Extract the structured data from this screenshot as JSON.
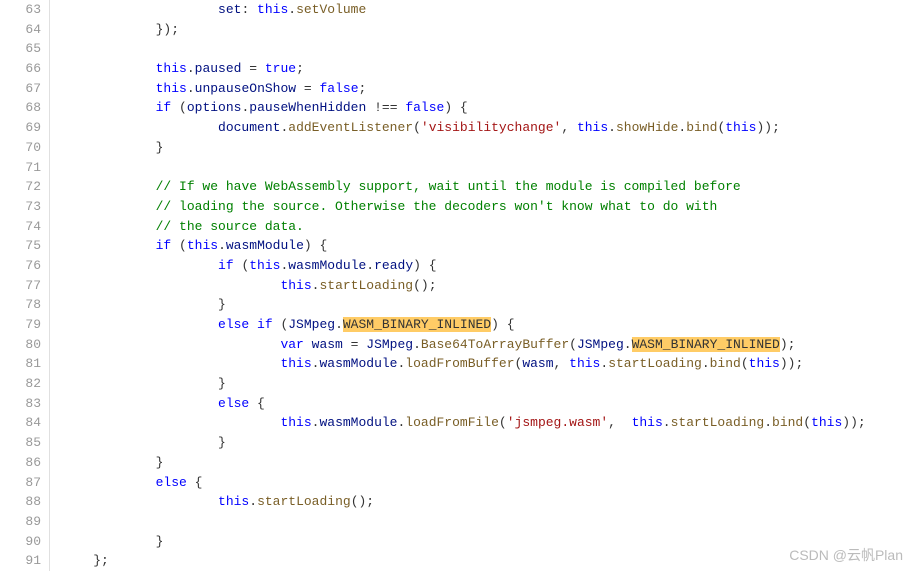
{
  "startLine": 63,
  "watermark": "CSDN @云帆Plan",
  "code": [
    {
      "i": "                    ",
      "t": [
        [
          "id",
          "set"
        ],
        [
          "p",
          ": "
        ],
        [
          "kw",
          "this"
        ],
        [
          "p",
          "."
        ],
        [
          "method",
          "setVolume"
        ]
      ]
    },
    {
      "i": "            ",
      "t": [
        [
          "p",
          "});"
        ]
      ]
    },
    {
      "i": "",
      "t": []
    },
    {
      "i": "            ",
      "t": [
        [
          "kw",
          "this"
        ],
        [
          "p",
          "."
        ],
        [
          "prop",
          "paused"
        ],
        [
          "p",
          " = "
        ],
        [
          "kw",
          "true"
        ],
        [
          "p",
          ";"
        ]
      ]
    },
    {
      "i": "            ",
      "t": [
        [
          "kw",
          "this"
        ],
        [
          "p",
          "."
        ],
        [
          "prop",
          "unpauseOnShow"
        ],
        [
          "p",
          " = "
        ],
        [
          "kw",
          "false"
        ],
        [
          "p",
          ";"
        ]
      ]
    },
    {
      "i": "            ",
      "t": [
        [
          "kw",
          "if"
        ],
        [
          "p",
          " ("
        ],
        [
          "id",
          "options"
        ],
        [
          "p",
          "."
        ],
        [
          "prop",
          "pauseWhenHidden"
        ],
        [
          "p",
          " !== "
        ],
        [
          "kw",
          "false"
        ],
        [
          "p",
          ") {"
        ]
      ]
    },
    {
      "i": "                    ",
      "t": [
        [
          "id",
          "document"
        ],
        [
          "p",
          "."
        ],
        [
          "method",
          "addEventListener"
        ],
        [
          "p",
          "("
        ],
        [
          "str",
          "'visibilitychange'"
        ],
        [
          "p",
          ", "
        ],
        [
          "kw",
          "this"
        ],
        [
          "p",
          "."
        ],
        [
          "method",
          "showHide"
        ],
        [
          "p",
          "."
        ],
        [
          "method",
          "bind"
        ],
        [
          "p",
          "("
        ],
        [
          "kw",
          "this"
        ],
        [
          "p",
          "));"
        ]
      ]
    },
    {
      "i": "            ",
      "t": [
        [
          "p",
          "}"
        ]
      ]
    },
    {
      "i": "",
      "t": []
    },
    {
      "i": "            ",
      "t": [
        [
          "cmt",
          "// If we have WebAssembly support, wait until the module is compiled before"
        ]
      ]
    },
    {
      "i": "            ",
      "t": [
        [
          "cmt",
          "// loading the source. Otherwise the decoders won't know what to do with"
        ]
      ]
    },
    {
      "i": "            ",
      "t": [
        [
          "cmt",
          "// the source data."
        ]
      ]
    },
    {
      "i": "            ",
      "t": [
        [
          "kw",
          "if"
        ],
        [
          "p",
          " ("
        ],
        [
          "kw",
          "this"
        ],
        [
          "p",
          "."
        ],
        [
          "prop",
          "wasmModule"
        ],
        [
          "p",
          ") {"
        ]
      ]
    },
    {
      "i": "                    ",
      "t": [
        [
          "kw",
          "if"
        ],
        [
          "p",
          " ("
        ],
        [
          "kw",
          "this"
        ],
        [
          "p",
          "."
        ],
        [
          "prop",
          "wasmModule"
        ],
        [
          "p",
          "."
        ],
        [
          "prop",
          "ready"
        ],
        [
          "p",
          ") {"
        ]
      ]
    },
    {
      "i": "                            ",
      "t": [
        [
          "kw",
          "this"
        ],
        [
          "p",
          "."
        ],
        [
          "method",
          "startLoading"
        ],
        [
          "p",
          "();"
        ]
      ]
    },
    {
      "i": "                    ",
      "t": [
        [
          "p",
          "}"
        ]
      ]
    },
    {
      "i": "                    ",
      "t": [
        [
          "kw",
          "else if"
        ],
        [
          "p",
          " ("
        ],
        [
          "id",
          "JSMpeg"
        ],
        [
          "p",
          "."
        ],
        [
          "hl",
          "WASM_BINARY_INLINED"
        ],
        [
          "p",
          ") {"
        ]
      ]
    },
    {
      "i": "                            ",
      "t": [
        [
          "kw",
          "var"
        ],
        [
          "p",
          " "
        ],
        [
          "id",
          "wasm"
        ],
        [
          "p",
          " = "
        ],
        [
          "id",
          "JSMpeg"
        ],
        [
          "p",
          "."
        ],
        [
          "method",
          "Base64ToArrayBuffer"
        ],
        [
          "p",
          "("
        ],
        [
          "id",
          "JSMpeg"
        ],
        [
          "p",
          "."
        ],
        [
          "hl",
          "WASM_BINARY_INLINED"
        ],
        [
          "p",
          ");"
        ]
      ]
    },
    {
      "i": "                            ",
      "t": [
        [
          "kw",
          "this"
        ],
        [
          "p",
          "."
        ],
        [
          "prop",
          "wasmModule"
        ],
        [
          "p",
          "."
        ],
        [
          "method",
          "loadFromBuffer"
        ],
        [
          "p",
          "("
        ],
        [
          "id",
          "wasm"
        ],
        [
          "p",
          ", "
        ],
        [
          "kw",
          "this"
        ],
        [
          "p",
          "."
        ],
        [
          "method",
          "startLoading"
        ],
        [
          "p",
          "."
        ],
        [
          "method",
          "bind"
        ],
        [
          "p",
          "("
        ],
        [
          "kw",
          "this"
        ],
        [
          "p",
          "));"
        ]
      ]
    },
    {
      "i": "                    ",
      "t": [
        [
          "p",
          "}"
        ]
      ]
    },
    {
      "i": "                    ",
      "t": [
        [
          "kw",
          "else"
        ],
        [
          "p",
          " {"
        ]
      ]
    },
    {
      "i": "                            ",
      "t": [
        [
          "kw",
          "this"
        ],
        [
          "p",
          "."
        ],
        [
          "prop",
          "wasmModule"
        ],
        [
          "p",
          "."
        ],
        [
          "method",
          "loadFromFile"
        ],
        [
          "p",
          "("
        ],
        [
          "str",
          "'jsmpeg.wasm'"
        ],
        [
          "p",
          ",  "
        ],
        [
          "kw",
          "this"
        ],
        [
          "p",
          "."
        ],
        [
          "method",
          "startLoading"
        ],
        [
          "p",
          "."
        ],
        [
          "method",
          "bind"
        ],
        [
          "p",
          "("
        ],
        [
          "kw",
          "this"
        ],
        [
          "p",
          "));"
        ]
      ]
    },
    {
      "i": "                    ",
      "t": [
        [
          "p",
          "}"
        ]
      ]
    },
    {
      "i": "            ",
      "t": [
        [
          "p",
          "}"
        ]
      ]
    },
    {
      "i": "            ",
      "t": [
        [
          "kw",
          "else"
        ],
        [
          "p",
          " {"
        ]
      ]
    },
    {
      "i": "                    ",
      "t": [
        [
          "kw",
          "this"
        ],
        [
          "p",
          "."
        ],
        [
          "method",
          "startLoading"
        ],
        [
          "p",
          "();"
        ]
      ]
    },
    {
      "i": "",
      "t": []
    },
    {
      "i": "            ",
      "t": [
        [
          "p",
          "}"
        ]
      ]
    },
    {
      "i": "    ",
      "t": [
        [
          "p",
          "};"
        ]
      ]
    }
  ]
}
